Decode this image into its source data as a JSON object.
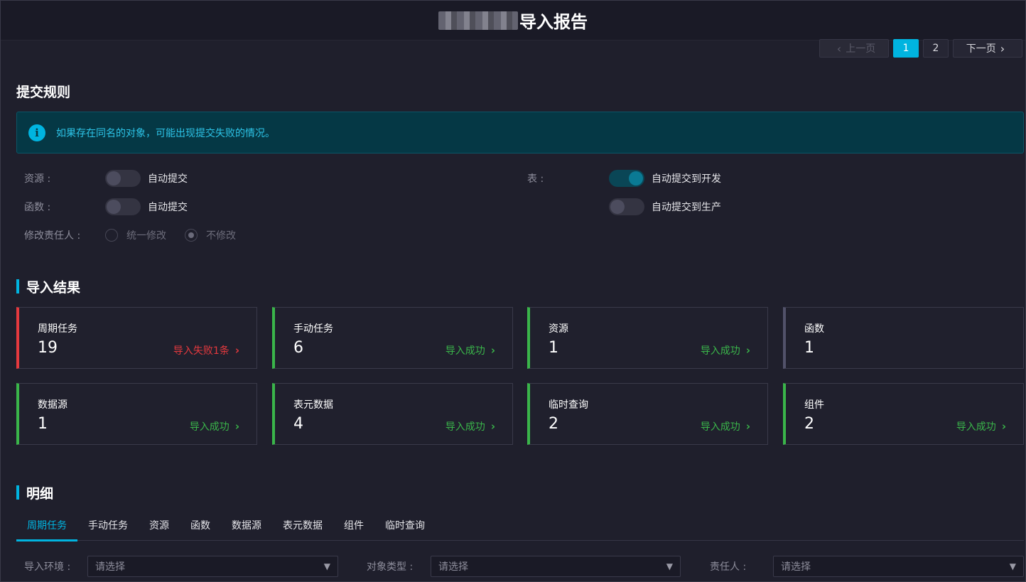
{
  "header": {
    "title": "导入报告"
  },
  "pager": {
    "prev": "上一页",
    "pages": [
      "1",
      "2"
    ],
    "next": "下一页"
  },
  "rules": {
    "heading": "提交规则",
    "alert": "如果存在同名的对象，可能出现提交失败的情况。",
    "resource": {
      "label": "资源 :",
      "toggle_text": "自动提交"
    },
    "function": {
      "label": "函数 :",
      "toggle_text": "自动提交"
    },
    "table": {
      "label": "表 :",
      "dev_text": "自动提交到开发",
      "prod_text": "自动提交到生产"
    },
    "owner": {
      "label": "修改责任人 :",
      "option_unified": "统一修改",
      "option_none": "不修改"
    }
  },
  "results": {
    "heading": "导入结果",
    "cards": [
      {
        "label": "周期任务",
        "count": "19",
        "status": "导入失败1条",
        "state": "fail"
      },
      {
        "label": "手动任务",
        "count": "6",
        "status": "导入成功",
        "state": "success"
      },
      {
        "label": "资源",
        "count": "1",
        "status": "导入成功",
        "state": "success"
      },
      {
        "label": "函数",
        "count": "1",
        "status": "",
        "state": "none"
      },
      {
        "label": "数据源",
        "count": "1",
        "status": "导入成功",
        "state": "success"
      },
      {
        "label": "表元数据",
        "count": "4",
        "status": "导入成功",
        "state": "success"
      },
      {
        "label": "临时查询",
        "count": "2",
        "status": "导入成功",
        "state": "success"
      },
      {
        "label": "组件",
        "count": "2",
        "status": "导入成功",
        "state": "success"
      }
    ]
  },
  "details": {
    "heading": "明细",
    "tabs": [
      "周期任务",
      "手动任务",
      "资源",
      "函数",
      "数据源",
      "表元数据",
      "组件",
      "临时查询"
    ],
    "filters": [
      {
        "label": "导入环境 :",
        "placeholder": "请选择"
      },
      {
        "label": "对象类型 :",
        "placeholder": "请选择"
      },
      {
        "label": "责任人 :",
        "placeholder": "请选择"
      }
    ]
  },
  "colors": {
    "accent": "#00b4e0",
    "success": "#3ab54a",
    "fail": "#e5393e",
    "background": "#1f1f2c"
  }
}
